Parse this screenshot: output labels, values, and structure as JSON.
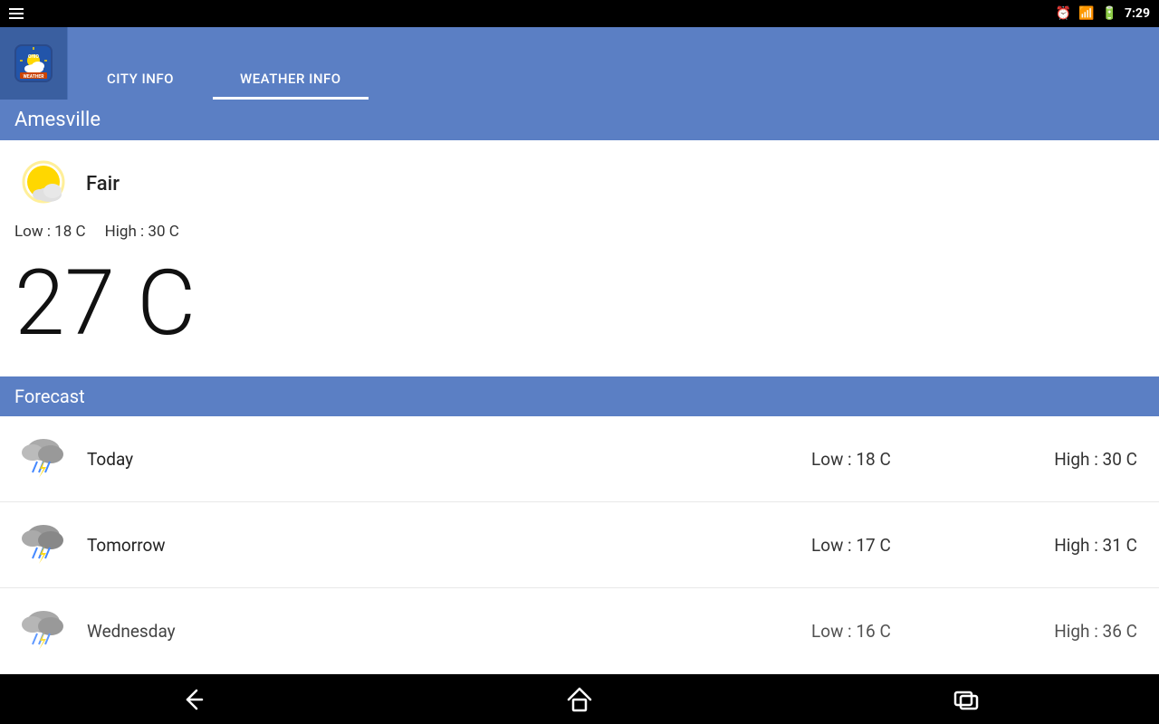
{
  "app": {
    "name": "OHIO WeAthER",
    "logo_line1": "OHIO",
    "logo_line2": "WEATHER"
  },
  "status_bar": {
    "time": "7:29"
  },
  "nav": {
    "tabs": [
      {
        "id": "city-info",
        "label": "CITY INFO",
        "active": false
      },
      {
        "id": "weather-info",
        "label": "WEATHER INFO",
        "active": true
      }
    ]
  },
  "city": {
    "name": "Amesville"
  },
  "current_weather": {
    "condition": "Fair",
    "low": "Low : 18 C",
    "high": "High : 30 C",
    "temp": "27 C"
  },
  "forecast": {
    "title": "Forecast",
    "items": [
      {
        "day": "Today",
        "low": "Low : 18 C",
        "high": "High : 30 C",
        "icon": "storm"
      },
      {
        "day": "Tomorrow",
        "low": "Low : 17 C",
        "high": "High : 31 C",
        "icon": "storm"
      },
      {
        "day": "Wednesday",
        "low": "Low : 16 C",
        "high": "High : 36 C",
        "icon": "storm"
      }
    ]
  },
  "bottom_nav": {
    "back_label": "←",
    "home_label": "⌂",
    "recents_label": "▭"
  }
}
